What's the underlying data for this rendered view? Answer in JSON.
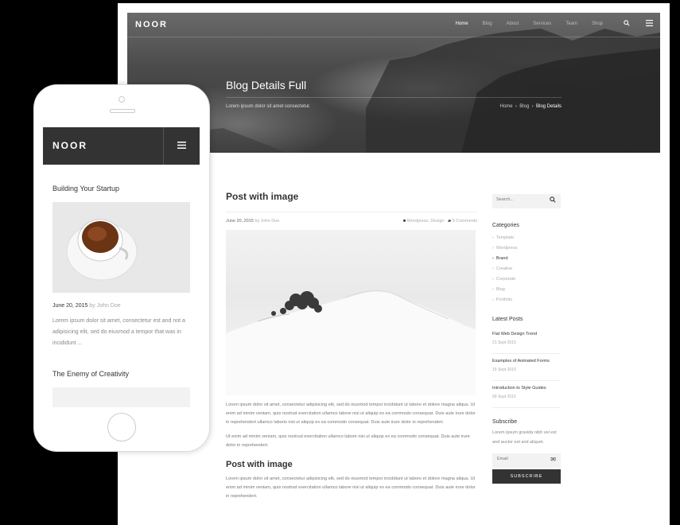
{
  "desktop": {
    "nav": {
      "logo": "NOOR",
      "items": [
        "Home",
        "Blog",
        "About",
        "Services",
        "Team",
        "Shop"
      ],
      "active": "Home",
      "search_icon": "search-icon",
      "menu_icon": "hamburger-icon"
    },
    "hero": {
      "title": "Blog Details Full",
      "subtitle": "Lorem ipsum dolor sit amet consectetur.",
      "breadcrumb": [
        "Home",
        "Blog",
        "Blog Details"
      ]
    },
    "post": {
      "title": "Post with image",
      "date": "June 20, 2015",
      "by_prefix": "by",
      "author": "John Doe",
      "categories": "Wordpress, Design",
      "comments": "5 Comments",
      "para1": "Lorem ipsum dolor sit amet, consectetur adipisicing elit, sed do eiusmod tempor incididunt ut labore et dolore magna aliqua. Ut enim ad minim veniam, quis nostrud exercitation ullamco labore nisi ut aliquip ex ea commodo consequat. Duis aute irure dolor in reprehendert ullamco laboris nisi ut aliquip ex ea commodo consequat. Duis aute irure dolor in reprehendert.",
      "para2": "Ut enim ad minim veniam, quis nostrud exercitation ullamco labore nisi ut aliquip ex ea commodo consequat. Duis aute irure dolor in reprehendert.",
      "title2": "Post with image",
      "para3": "Lorem ipsum dolor sit amet, consectetur adipisicing elit, sed do eiusmod tempor incididunt ut labore et dolore magna aliqua. Ut enim ad minim veniam, quis nostrud exercitation ullamco labore nisi ut aliquip ex ea commodo consequat. Duis aute irure dolor in reprehendert."
    },
    "sidebar": {
      "search_placeholder": "Search...",
      "categories_title": "Categories",
      "categories": [
        "Template",
        "Wordpress",
        "Brand",
        "Creative",
        "Corporate",
        "Blog",
        "Portfolio"
      ],
      "active_category": "Brand",
      "latest_title": "Latest Posts",
      "latest": [
        {
          "title": "Flat Web Design Trend",
          "date": "21 Sept 2015"
        },
        {
          "title": "Examples of Animated Forms",
          "date": "15 Sept 2015"
        },
        {
          "title": "Introduction to Style Guides",
          "date": "09 Sept 2015"
        }
      ],
      "subscribe_title": "Subscribe",
      "subscribe_text": "Lorem ipsum gravida nibh vel est and auctor est and aliquet.",
      "email_placeholder": "Email",
      "subscribe_button": "SUBSCRIBE"
    }
  },
  "mobile": {
    "logo": "NOOR",
    "post_title": "Building Your Startup",
    "date": "June 20, 2015",
    "by_prefix": "by",
    "author": "John Doe",
    "excerpt": "Lorem ipsum dolor sit amet, consectetur est and not a adipisicing elit, sed do eiusmod a tempor that was in incididunt ...",
    "post_title2": "The Enemy of Creativity"
  }
}
